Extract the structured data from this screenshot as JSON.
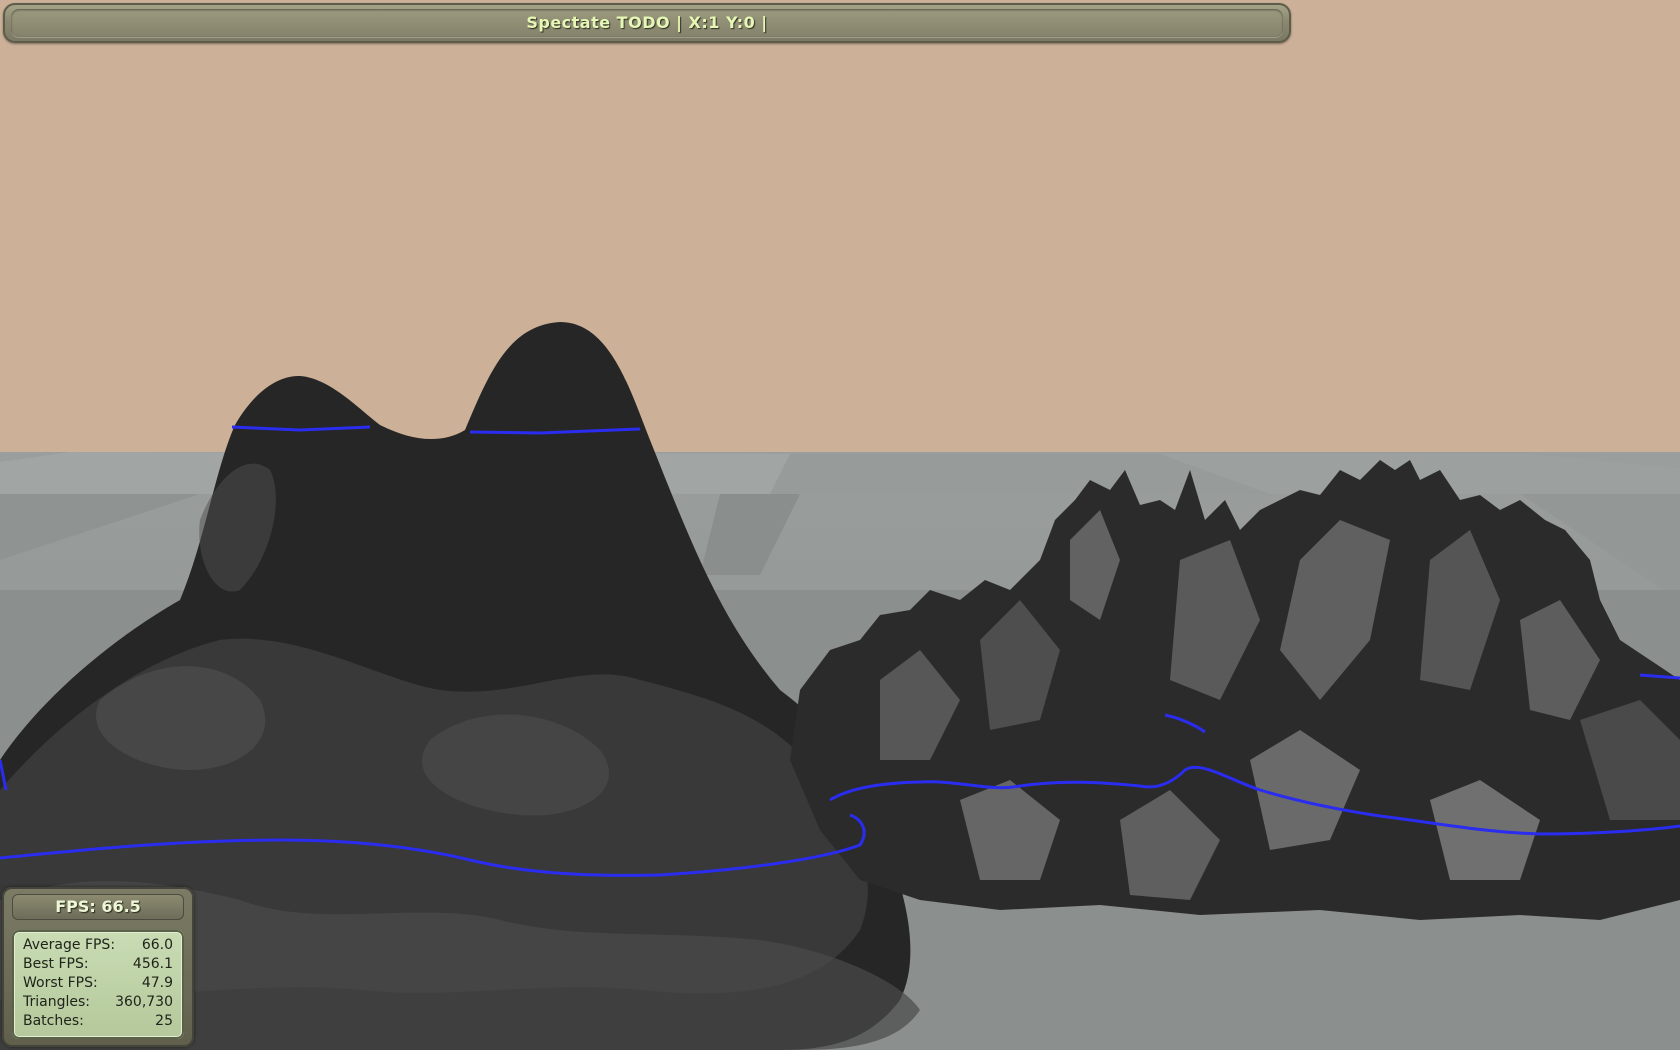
{
  "title_bar": {
    "text": "Spectate TODO | X:1 Y:0 |"
  },
  "stats": {
    "fps_header": "FPS: 66.5",
    "rows": [
      {
        "label": "Average FPS:",
        "value": "66.0"
      },
      {
        "label": "Best FPS:",
        "value": "456.1"
      },
      {
        "label": "Worst FPS:",
        "value": "47.9"
      },
      {
        "label": "Triangles:",
        "value": "360,730"
      },
      {
        "label": "Batches:",
        "value": "25"
      }
    ]
  },
  "colors": {
    "sky": "#ccb198",
    "ground": "#8c908e",
    "terrain": "#1c1c1c",
    "contour_line": "#2a2cf0",
    "hud_text": "#e6f7b5"
  }
}
